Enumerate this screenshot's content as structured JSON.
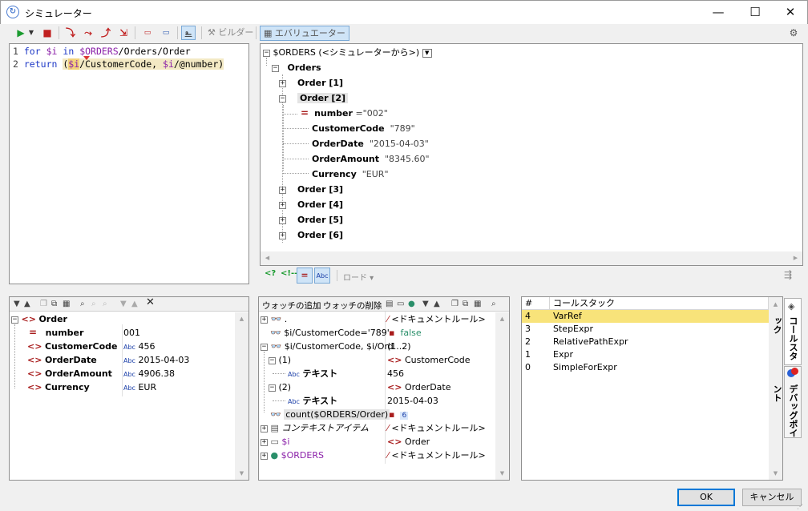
{
  "window": {
    "title": "シミュレーター",
    "minimize": "—",
    "maximize": "☐",
    "close": "✕"
  },
  "toolbar": {
    "builder_label": "ビルダー",
    "evaluator_label": "エバリュエーター"
  },
  "editor": {
    "lines": [
      {
        "num": "1",
        "tokens": [
          [
            "kw",
            "for"
          ],
          [
            "",
            "  "
          ],
          [
            "var",
            "$i"
          ],
          [
            "",
            ""
          ],
          [
            "kw",
            " in "
          ],
          [
            "var",
            "$ORDERS"
          ],
          [
            "",
            "/Orders/Order"
          ]
        ]
      },
      {
        "num": "2",
        "tokens": [
          [
            "kw",
            "return"
          ],
          [
            "",
            " ("
          ],
          [
            "var",
            "$i"
          ],
          [
            "",
            "/CustomerCode, "
          ],
          [
            "var",
            "$i"
          ],
          [
            "",
            "/@number)"
          ]
        ]
      }
    ]
  },
  "source_tree": {
    "root": "$ORDERS (<シミュレーターから>)",
    "orders": "Orders",
    "order1": "Order [1]",
    "order2": "Order [2]",
    "number_name": "number",
    "number_val": "=\"002\"",
    "customer_name": "CustomerCode",
    "customer_val": "\"789\"",
    "date_name": "OrderDate",
    "date_val": "\"2015-04-03\"",
    "amount_name": "OrderAmount",
    "amount_val": "\"8345.60\"",
    "currency_name": "Currency",
    "currency_val": "\"EUR\"",
    "order3": "Order [3]",
    "order4": "Order [4]",
    "order5": "Order [5]",
    "order6": "Order [6]",
    "footer_load": "ロード"
  },
  "context_tree": {
    "root": "Order",
    "rows": [
      {
        "name": "number",
        "val": "001",
        "abc": false
      },
      {
        "name": "CustomerCode",
        "val": "456",
        "abc": true
      },
      {
        "name": "OrderDate",
        "val": "2015-04-03",
        "abc": true
      },
      {
        "name": "OrderAmount",
        "val": "4906.38",
        "abc": true
      },
      {
        "name": "Currency",
        "val": "EUR",
        "abc": true
      }
    ]
  },
  "watch": {
    "add_label": "ウォッチの追加",
    "remove_label": "ウォッチの削除",
    "r0_left": ".",
    "r0_right": "<ドキュメントルール>",
    "r1_left": "$i/CustomerCode='789'",
    "r1_right": "false",
    "r2_left": "$i/CustomerCode, $i/Ord",
    "r2_right": "(1..2)",
    "r3_left": "(1)",
    "r3_right": "CustomerCode",
    "r4_left": "テキスト",
    "r4_right": "456",
    "r5_left": "(2)",
    "r5_right": "OrderDate",
    "r6_left": "テキスト",
    "r6_right": "2015-04-03",
    "r7_left": "count($ORDERS/Order)",
    "r7_right": "6",
    "r8_left": "コンテキストアイテム",
    "r8_right": "<ドキュメントルール>",
    "r9_left": "$i",
    "r9_right": "Order",
    "r10_left": "$ORDERS",
    "r10_right": "<ドキュメントルール>"
  },
  "callstack": {
    "col_num": "#",
    "col_name": "コールスタック",
    "rows": [
      {
        "num": "4",
        "name": "VarRef"
      },
      {
        "num": "3",
        "name": "StepExpr"
      },
      {
        "num": "2",
        "name": "RelativePathExpr"
      },
      {
        "num": "1",
        "name": "Expr"
      },
      {
        "num": "0",
        "name": "SimpleForExpr"
      }
    ],
    "tab_callstack": "コールスタック",
    "tab_breakpoints": "デバッグポイント"
  },
  "buttons": {
    "ok": "OK",
    "cancel": "キャンセル"
  }
}
